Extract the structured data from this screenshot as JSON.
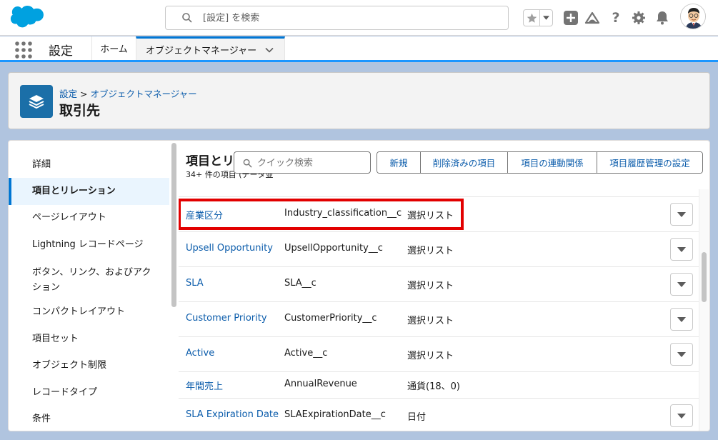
{
  "header": {
    "search_placeholder": "[設定] を検索"
  },
  "context_bar": {
    "app_name": "設定",
    "tabs": [
      {
        "label": "ホーム"
      },
      {
        "label": "オブジェクトマネージャー"
      }
    ]
  },
  "page_header": {
    "breadcrumb_root": "設定",
    "breadcrumb_sep": ">",
    "breadcrumb_current": "オブジェクトマネージャー",
    "title": "取引先"
  },
  "sidebar": {
    "items": [
      {
        "label": "詳細"
      },
      {
        "label": "項目とリレーション"
      },
      {
        "label": "ページレイアウト"
      },
      {
        "label": "Lightning レコードページ"
      },
      {
        "label": "ボタン、リンク、およびアクション"
      },
      {
        "label": "コンパクトレイアウト"
      },
      {
        "label": "項目セット"
      },
      {
        "label": "オブジェクト制限"
      },
      {
        "label": "レコードタイプ"
      },
      {
        "label": "条件"
      }
    ]
  },
  "section": {
    "title": "項目とリ",
    "subtitle": "34+ 件の項目 (データ並",
    "quick_search_placeholder": "クイック検索",
    "buttons": [
      {
        "label": "新規"
      },
      {
        "label": "削除済みの項目"
      },
      {
        "label": "項目の連動関係"
      },
      {
        "label": "項目履歴管理の設定"
      }
    ]
  },
  "fields": [
    {
      "label": "産業区分",
      "api": "Industry_classification__c",
      "type": "選択リスト"
    },
    {
      "label": "Upsell Opportunity",
      "api": "UpsellOpportunity__c",
      "type": "選択リスト"
    },
    {
      "label": "SLA",
      "api": "SLA__c",
      "type": "選択リスト"
    },
    {
      "label": "Customer Priority",
      "api": "CustomerPriority__c",
      "type": "選択リスト"
    },
    {
      "label": "Active",
      "api": "Active__c",
      "type": "選択リスト"
    },
    {
      "label": "年間売上",
      "api": "AnnualRevenue",
      "type": "通貨(18、0)"
    },
    {
      "label": "SLA Expiration Date",
      "api": "SLAExpirationDate__c",
      "type": "日付"
    }
  ],
  "colors": {
    "brand_blue": "#0176d3",
    "link_blue": "#0b5cab",
    "highlight_red": "#e20000",
    "logo_blue": "#00a1e0"
  }
}
